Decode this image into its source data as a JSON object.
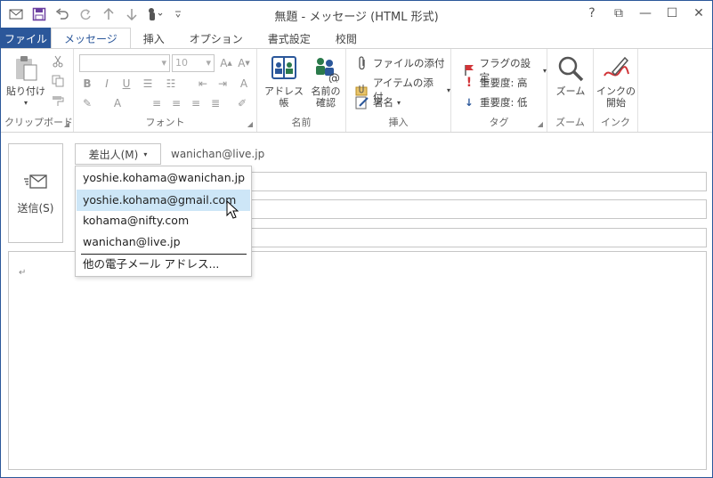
{
  "window": {
    "title": "無題 - メッセージ (HTML 形式)",
    "controls": [
      "?",
      "⧉",
      "—",
      "☐",
      "✕"
    ]
  },
  "tabs": [
    {
      "label": "ファイル"
    },
    {
      "label": "メッセージ"
    },
    {
      "label": "挿入"
    },
    {
      "label": "オプション"
    },
    {
      "label": "書式設定"
    },
    {
      "label": "校閲"
    }
  ],
  "ribbon": {
    "clipboard": {
      "paste_label": "貼り付け",
      "group_label": "クリップボード"
    },
    "font": {
      "size_value": "10",
      "group_label": "フォント",
      "bold": "B",
      "italic": "I",
      "underline": "U"
    },
    "names": {
      "address_book_label": "アドレス帳",
      "check_names_label_1": "名前の",
      "check_names_label_2": "確認",
      "group_label": "名前"
    },
    "include": {
      "attach_file": "ファイルの添付",
      "attach_item": "アイテムの添付",
      "signature": "署名",
      "group_label": "挿入"
    },
    "tags": {
      "follow_up": "フラグの設定",
      "high_importance": "重要度: 高",
      "low_importance": "重要度: 低",
      "group_label": "タグ"
    },
    "zoom": {
      "zoom_label": "ズーム",
      "group_label": "ズーム"
    },
    "ink": {
      "start_inking_1": "インクの",
      "start_inking_2": "開始",
      "group_label": "インク"
    }
  },
  "compose": {
    "send_label": "送信(S)",
    "from_label": "差出人(M)",
    "from_address": "wanichan@live.jp",
    "body_mark": "↵"
  },
  "from_dropdown": {
    "items": [
      "yoshie.kohama@wanichan.jp",
      "yoshie.kohama@gmail.com",
      "kohama@nifty.com",
      "wanichan@live.jp"
    ],
    "other": "他の電子メール アドレス...",
    "hovered_index": 1
  },
  "colors": {
    "accent": "#2b579a",
    "hover": "#cde6f7",
    "flag": "#d13438"
  }
}
